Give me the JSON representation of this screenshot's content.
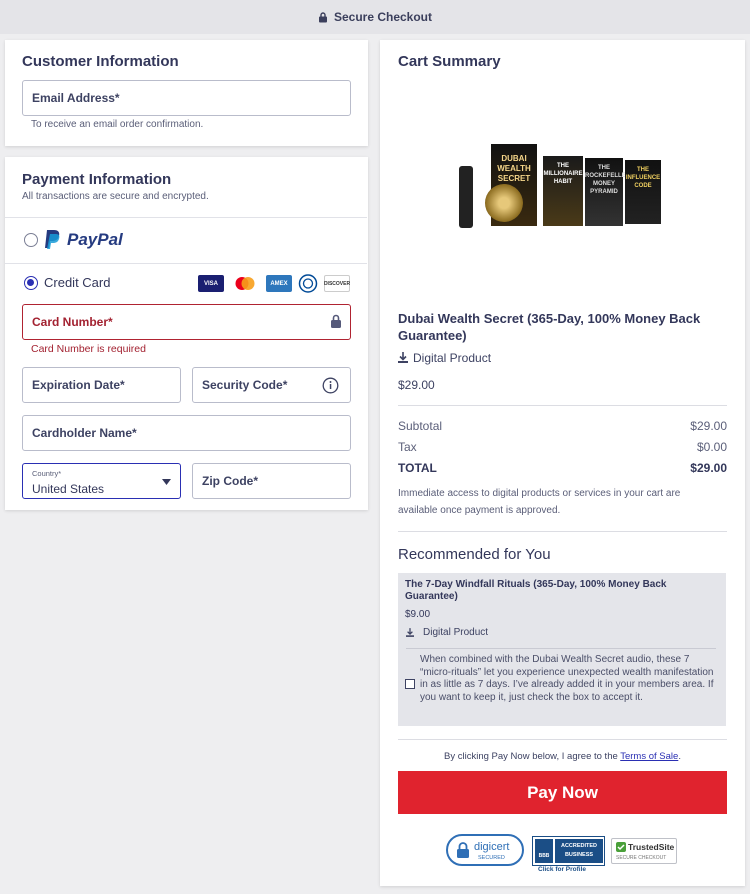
{
  "topbar": {
    "label": "Secure Checkout",
    "icon": "lock-icon"
  },
  "customer": {
    "title": "Customer Information",
    "email_label": "Email Address*",
    "email_hint": "To receive an email order confirmation."
  },
  "payment": {
    "title": "Payment Information",
    "subtitle": "All transactions are secure and encrypted.",
    "paypal_label": "PayPal",
    "credit_label": "Credit Card",
    "cards": [
      "VISA",
      "mastercard",
      "AMEX",
      "diners",
      "DISCOVER"
    ],
    "card_number_label": "Card Number*",
    "card_number_error": "Card Number is required",
    "expiration_label": "Expiration Date*",
    "security_label": "Security Code*",
    "cardholder_label": "Cardholder Name*",
    "country_label": "Country*",
    "country_value": "United States",
    "zip_label": "Zip Code*"
  },
  "cart": {
    "title": "Cart Summary",
    "product_image_text": {
      "main": "DUBAI WEALTH SECRET",
      "b2": "THE MILLIONAIRE HABIT",
      "b3": "THE ROCKEFELLER MONEY PYRAMID",
      "b4": "THE INFLUENCE CODE"
    },
    "product_name": "Dubai Wealth Secret (365-Day, 100% Money Back Guarantee)",
    "product_type": "Digital Product",
    "product_price": "$29.00",
    "subtotal_label": "Subtotal",
    "subtotal_value": "$29.00",
    "tax_label": "Tax",
    "tax_value": "$0.00",
    "total_label": "TOTAL",
    "total_value": "$29.00",
    "access_note": "Immediate access to digital products or services in your cart are available once payment is approved."
  },
  "recommended": {
    "title": "Recommended for You",
    "name": "The 7-Day Windfall Rituals (365-Day, 100% Money Back Guarantee)",
    "price": "$9.00",
    "type": "Digital Product",
    "description": "When combined with the Dubai Wealth Secret audio, these 7 “micro-rituals” let you experience unexpected wealth manifestation in as little as 7 days. I’ve already added it in your members area. If you want to keep it, just check the box to accept it."
  },
  "agreement": {
    "prefix": "By clicking Pay Now below, I agree to the ",
    "link": "Terms of Sale",
    "suffix": "."
  },
  "pay_button": "Pay Now",
  "trust": {
    "digicert": "digicert",
    "digicert_sub": "SECURED",
    "bbb_line1": "ACCREDITED",
    "bbb_line2": "BUSINESS",
    "bbb_caption": "Click for Profile",
    "trustedsite": "TrustedSite",
    "trustedsite_sub": "SECURE CHECKOUT"
  },
  "colors": {
    "accent": "#2a2fb3",
    "error": "#b02331",
    "pay": "#e0232e"
  }
}
